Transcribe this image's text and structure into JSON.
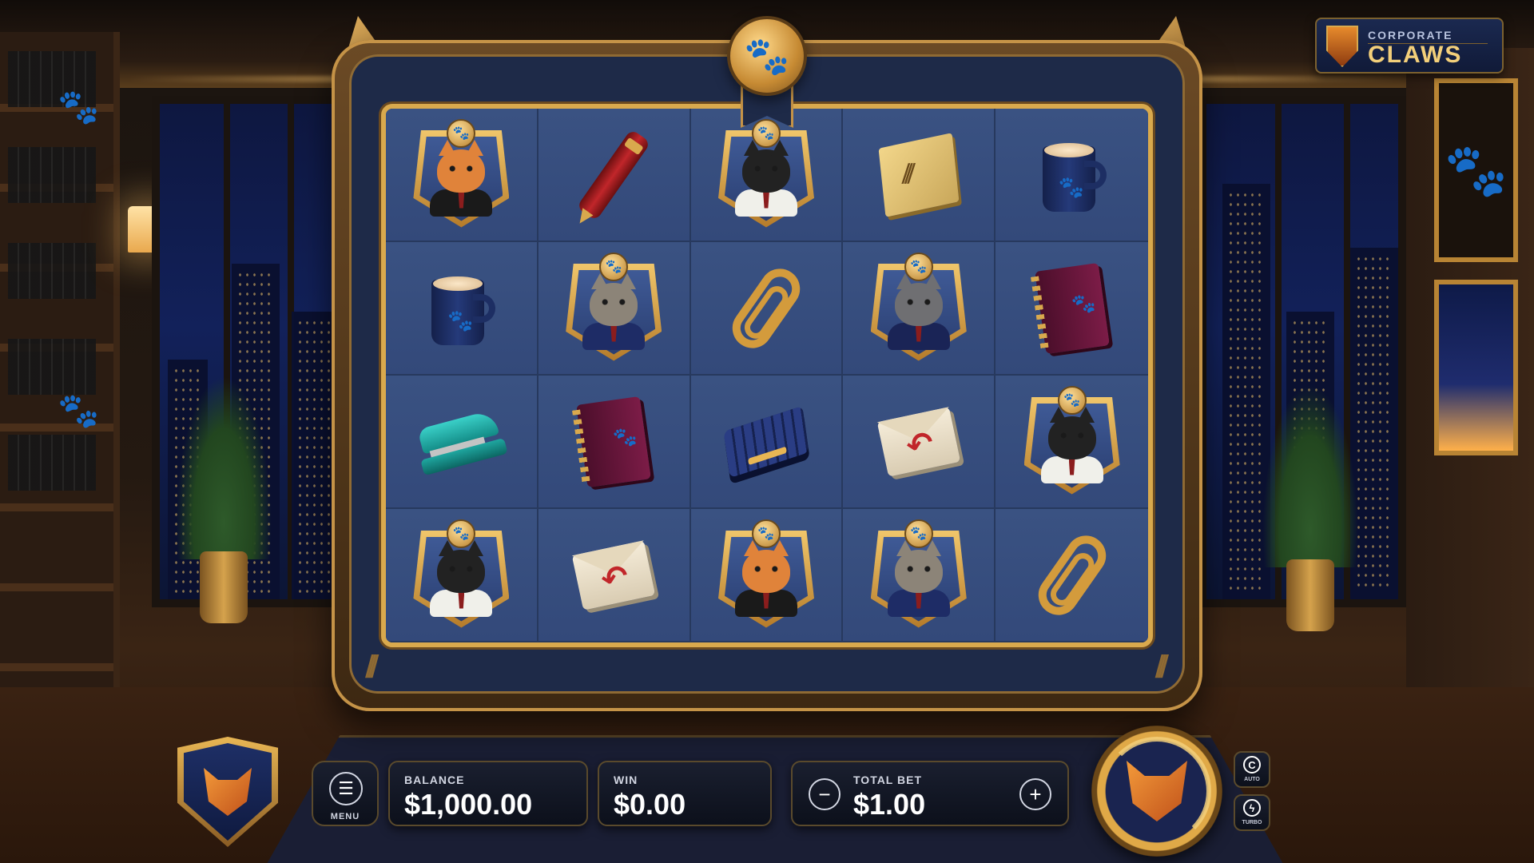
{
  "game": {
    "logo_top": "CORPORATE",
    "logo_main": "CLAWS"
  },
  "reels": {
    "rows": [
      [
        "cat-boss-orange",
        "red-pen",
        "cat-tuxedo",
        "claw-sticky-note",
        "coffee-mug"
      ],
      [
        "coffee-mug",
        "cat-tabby-glasses",
        "paper-clip",
        "cat-grey-security",
        "planner"
      ],
      [
        "stapler",
        "planner",
        "keyboard",
        "envelope",
        "cat-tuxedo"
      ],
      [
        "cat-tuxedo",
        "envelope",
        "cat-boss-orange",
        "cat-tabby-glasses",
        "paper-clip"
      ]
    ]
  },
  "hud": {
    "menu_label": "MENU",
    "balance_label": "BALANCE",
    "balance_value": "$1,000.00",
    "win_label": "WIN",
    "win_value": "$0.00",
    "bet_label": "TOTAL BET",
    "bet_value": "$1.00",
    "minus_symbol": "−",
    "plus_symbol": "+",
    "auto_label": "AUTO",
    "turbo_label": "TURBO"
  },
  "colors": {
    "gold": "#d9a94d",
    "reel_bg": "#30456f",
    "panel_navy": "#1e2a48"
  }
}
